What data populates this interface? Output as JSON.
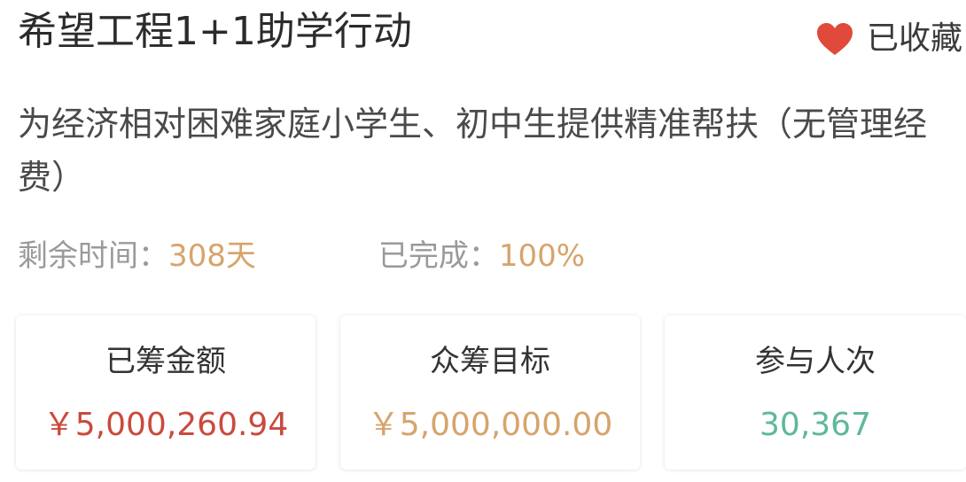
{
  "project": {
    "title": "希望工程1+1助学行动",
    "favorite_label": "已收藏",
    "subtitle": "为经济相对困难家庭小学生、初中生提供精准帮扶（无管理经费）"
  },
  "meta": {
    "remaining_label": "剩余时间：",
    "remaining_value": "308天",
    "completed_label": "已完成：",
    "completed_value": "100%"
  },
  "stats": [
    {
      "label": "已筹金额",
      "value": "￥5,000,260.94",
      "color": "#c94a3d"
    },
    {
      "label": "众筹目标",
      "value": "￥5,000,000.00",
      "color": "#d6a46b"
    },
    {
      "label": "参与人次",
      "value": "30,367",
      "color": "#5fb89a"
    }
  ],
  "colors": {
    "heart": "#e04a3a",
    "accent": "#d6a46b"
  },
  "icons": {
    "favorite": "heart-icon"
  }
}
